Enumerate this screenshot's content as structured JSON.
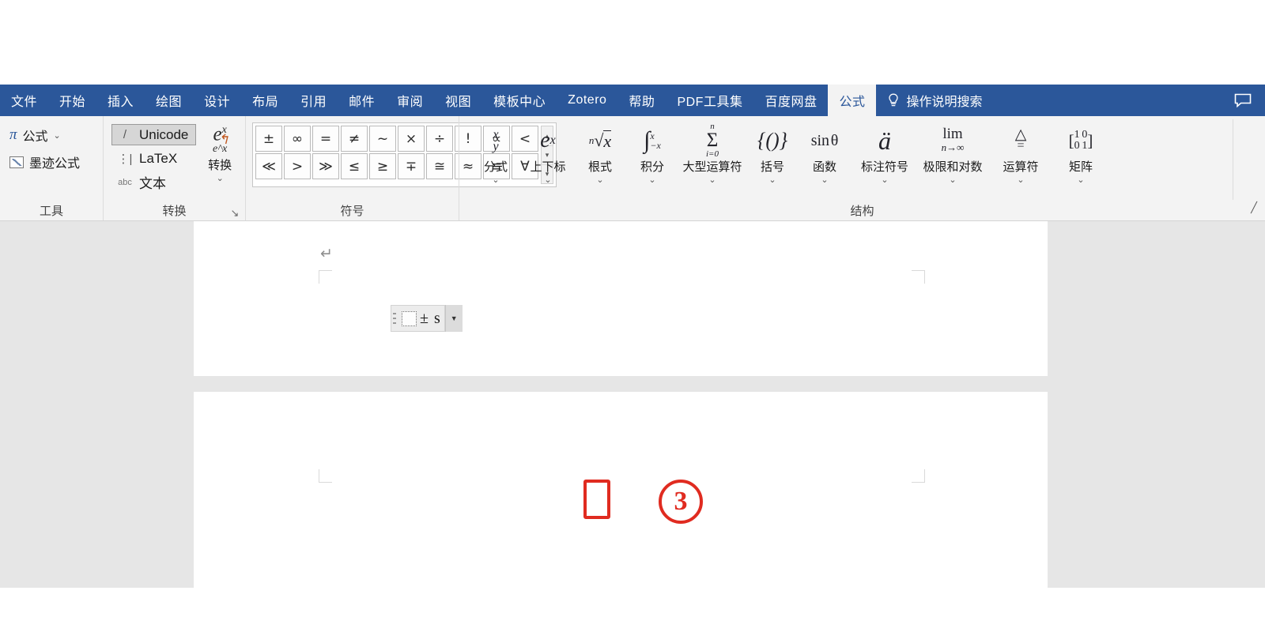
{
  "window": {
    "title_bar_empty": "",
    "share_icon": "comment-icon"
  },
  "tabs": [
    {
      "label": "文件",
      "active": false
    },
    {
      "label": "开始",
      "active": false
    },
    {
      "label": "插入",
      "active": false
    },
    {
      "label": "绘图",
      "active": false
    },
    {
      "label": "设计",
      "active": false
    },
    {
      "label": "布局",
      "active": false
    },
    {
      "label": "引用",
      "active": false
    },
    {
      "label": "邮件",
      "active": false
    },
    {
      "label": "审阅",
      "active": false
    },
    {
      "label": "视图",
      "active": false
    },
    {
      "label": "模板中心",
      "active": false
    },
    {
      "label": "Zotero",
      "active": false
    },
    {
      "label": "帮助",
      "active": false
    },
    {
      "label": "PDF工具集",
      "active": false
    },
    {
      "label": "百度网盘",
      "active": false
    },
    {
      "label": "公式",
      "active": true
    }
  ],
  "tell_me": {
    "label": "操作说明搜索",
    "icon": "lightbulb-icon"
  },
  "ribbon": {
    "groups": {
      "tools": {
        "label": "工具",
        "items": [
          {
            "label": "公式",
            "icon": "pi-icon",
            "has_caret": true
          },
          {
            "label": "墨迹公式",
            "icon": "ink-equation-icon",
            "has_caret": false
          }
        ]
      },
      "conversions": {
        "label": "转换",
        "dialog_launcher": "↘",
        "options": [
          {
            "label": "Unicode",
            "glyph": "/",
            "selected": true
          },
          {
            "label": "LaTeX",
            "glyph": "⋮|",
            "selected": false
          },
          {
            "label": "文本",
            "glyph": "abc",
            "selected": false
          }
        ],
        "convert_button": {
          "label": "转换",
          "icon_top": "e",
          "icon_top_sup": "x",
          "icon_bottom": "e^x",
          "has_caret": true
        }
      },
      "symbols": {
        "label": "符号",
        "grid": [
          "±",
          "∞",
          "=",
          "≠",
          "~",
          "×",
          "÷",
          "!",
          "∝",
          "<",
          "≪",
          ">",
          "≫",
          "≤",
          "≥",
          "∓",
          "≅",
          "≈",
          "≡",
          "∀"
        ],
        "scroll": {
          "up": "▴",
          "down": "▾",
          "more": "▾"
        }
      },
      "structures": {
        "label": "结构",
        "items": [
          {
            "label": "分式",
            "icon": "fraction-icon",
            "has_caret": true,
            "wide": false
          },
          {
            "label": "上下标",
            "icon": "script-icon",
            "has_caret": true,
            "wide": false
          },
          {
            "label": "根式",
            "icon": "radical-icon",
            "has_caret": true,
            "wide": false
          },
          {
            "label": "积分",
            "icon": "integral-icon",
            "has_caret": true,
            "wide": false
          },
          {
            "label": "大型运算符",
            "icon": "large-operator-icon",
            "has_caret": true,
            "wide": true
          },
          {
            "label": "括号",
            "icon": "bracket-icon",
            "has_caret": true,
            "wide": false
          },
          {
            "label": "函数",
            "icon": "function-icon",
            "has_caret": true,
            "wide": false
          },
          {
            "label": "标注符号",
            "icon": "accent-icon",
            "has_caret": true,
            "wide": true
          },
          {
            "label": "极限和对数",
            "icon": "limit-log-icon",
            "has_caret": true,
            "wide": true
          },
          {
            "label": "运算符",
            "icon": "operator-icon",
            "has_caret": true,
            "wide": true
          },
          {
            "label": "矩阵",
            "icon": "matrix-icon",
            "has_caret": true,
            "wide": false
          }
        ]
      }
    },
    "collapse_icon": "collapse-ribbon-icon"
  },
  "document": {
    "paragraph_mark": "↵",
    "equation": {
      "placeholder_slot": "empty-slot",
      "text": "± s",
      "dropdown_icon": "▼",
      "handle_icon": "equation-handle-icon"
    }
  },
  "annotations": {
    "rectangle": {
      "color": "#e02b20",
      "target": "equation-placeholder-slot"
    },
    "circle": {
      "color": "#e02b20",
      "label": "③",
      "number": "3"
    }
  },
  "colors": {
    "ribbon_blue": "#2b579a",
    "ribbon_bg": "#f3f3f3",
    "canvas_gray": "#e6e6e6",
    "annotation_red": "#e02b20"
  }
}
